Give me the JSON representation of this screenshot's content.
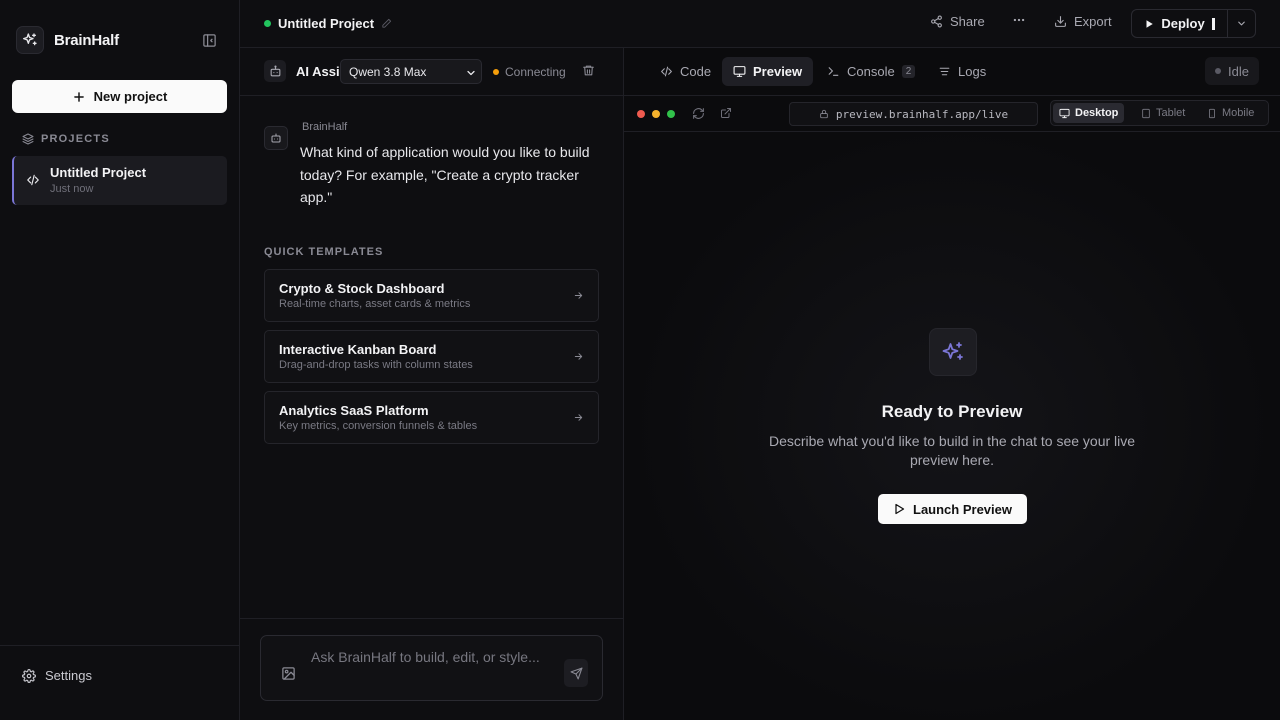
{
  "sidebar": {
    "brand": "BrainHalf",
    "new_project_label": "New project",
    "projects_header": "PROJECTS",
    "projects": [
      {
        "title": "Untitled Project",
        "subtitle": "Just now"
      }
    ],
    "settings_label": "Settings"
  },
  "topbar": {
    "project_name": "Untitled Project",
    "share_label": "Share",
    "export_label": "Export",
    "deploy_label": "Deploy"
  },
  "chat": {
    "assistant_title": "AI Assistant",
    "model": "Qwen 3.8 Max",
    "status": "Connecting",
    "message_author": "BrainHalf",
    "message_text": "What kind of application would you like to build today? For example, \"Create a crypto tracker app.\"",
    "templates_header": "QUICK TEMPLATES",
    "templates": [
      {
        "title": "Crypto & Stock Dashboard",
        "subtitle": "Real-time charts, asset cards & metrics"
      },
      {
        "title": "Interactive Kanban Board",
        "subtitle": "Drag-and-drop tasks with column states"
      },
      {
        "title": "Analytics SaaS Platform",
        "subtitle": "Key metrics, conversion funnels & tables"
      }
    ],
    "input_placeholder": "Ask BrainHalf to build, edit, or style..."
  },
  "preview": {
    "tabs": [
      {
        "label": "Code"
      },
      {
        "label": "Preview"
      },
      {
        "label": "Console",
        "badge": "2"
      },
      {
        "label": "Logs"
      }
    ],
    "status": "Idle",
    "url": "preview.brainhalf.app/live",
    "devices": [
      "Desktop",
      "Tablet",
      "Mobile"
    ],
    "empty_title": "Ready to Preview",
    "empty_desc": "Describe what you'd like to build in the chat to see your live preview here.",
    "launch_label": "Launch Preview"
  },
  "colors": {
    "accent": "#7b76d6",
    "status_online": "#22c55e",
    "status_connecting": "#f59e0b",
    "background": "#0e0e11"
  }
}
